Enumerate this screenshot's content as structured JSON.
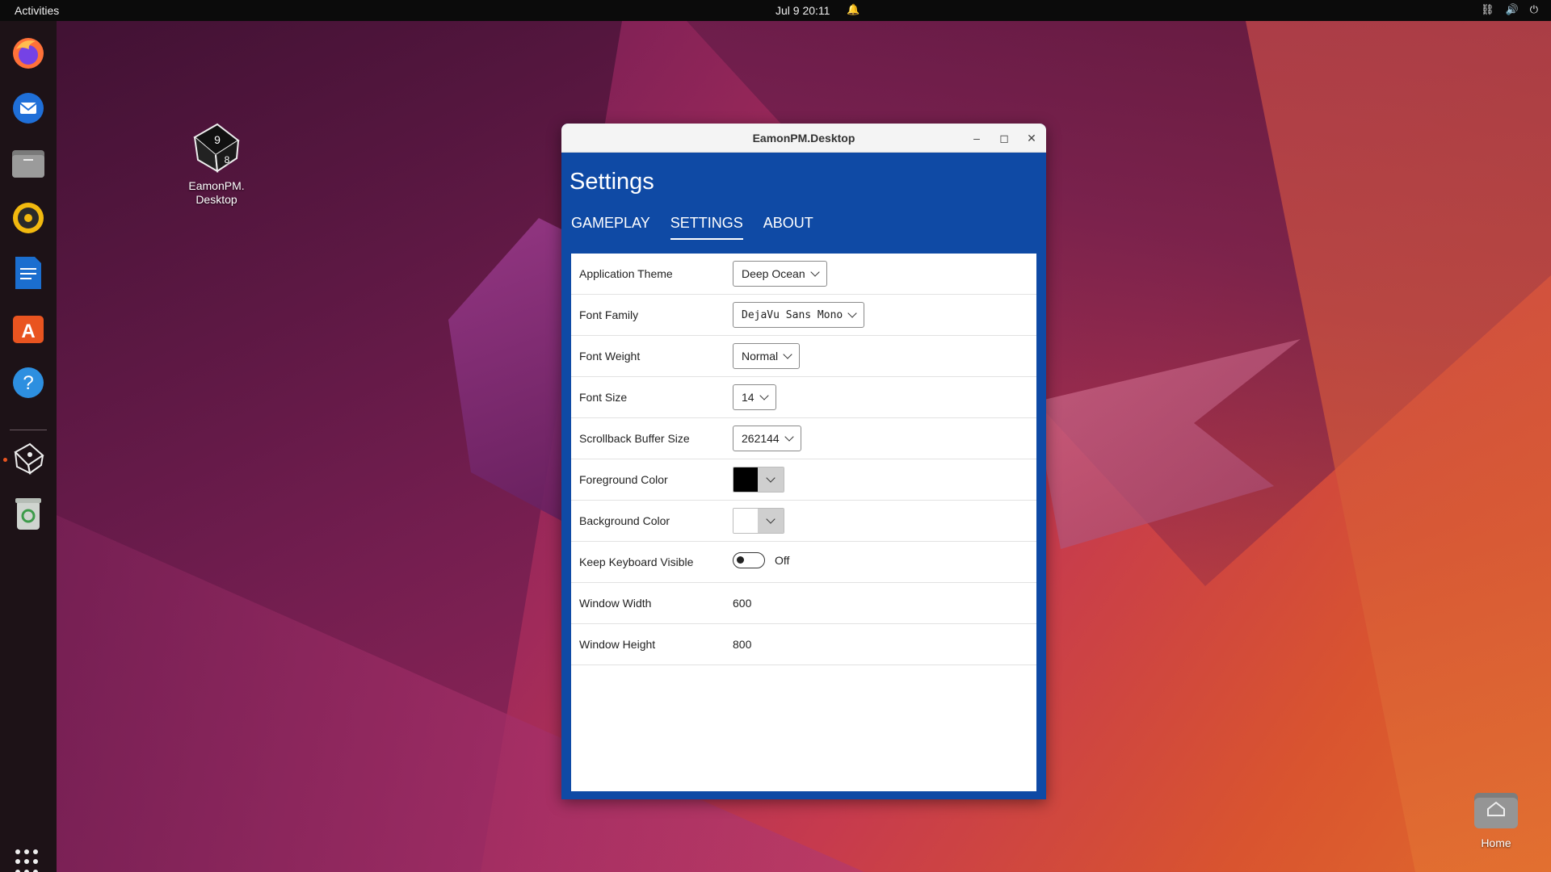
{
  "topbar": {
    "activities": "Activities",
    "clock": "Jul 9  20:11",
    "bell_icon": "bell-icon",
    "tray_icons": [
      "network-icon",
      "volume-icon",
      "power-icon"
    ]
  },
  "dock": {
    "items": [
      "firefox-icon",
      "thunderbird-icon",
      "files-icon",
      "rhythmbox-icon",
      "writer-icon",
      "app-center-icon",
      "help-icon",
      "eamonpm-icon",
      "trash-icon"
    ],
    "apps_grid_icon": "show-apps-icon",
    "accent": "#e95420"
  },
  "desktop": {
    "app_icon_label_line1": "EamonPM.",
    "app_icon_label_line2": "Desktop",
    "home_label": "Home"
  },
  "window": {
    "title": "EamonPM.Desktop",
    "minimize": "–",
    "maximize": "◻",
    "close": "✕",
    "accent": "#0f4aa5",
    "app_title": "Settings",
    "tabs": [
      {
        "label": "GAMEPLAY"
      },
      {
        "label": "SETTINGS",
        "active": true
      },
      {
        "label": "ABOUT"
      }
    ],
    "settings": {
      "theme": {
        "label": "Application Theme",
        "value": "Deep Ocean"
      },
      "font_family": {
        "label": "Font Family",
        "value": "DejaVu Sans Mono"
      },
      "font_weight": {
        "label": "Font Weight",
        "value": "Normal"
      },
      "font_size": {
        "label": "Font Size",
        "value": "14"
      },
      "scrollback": {
        "label": "Scrollback Buffer Size",
        "value": "262144"
      },
      "foreground": {
        "label": "Foreground Color",
        "value": "#000000"
      },
      "background": {
        "label": "Background Color",
        "value": "#ffffff"
      },
      "keyboard": {
        "label": "Keep Keyboard Visible",
        "state": "Off"
      },
      "width": {
        "label": "Window Width",
        "value": "600"
      },
      "height": {
        "label": "Window Height",
        "value": "800"
      }
    }
  }
}
